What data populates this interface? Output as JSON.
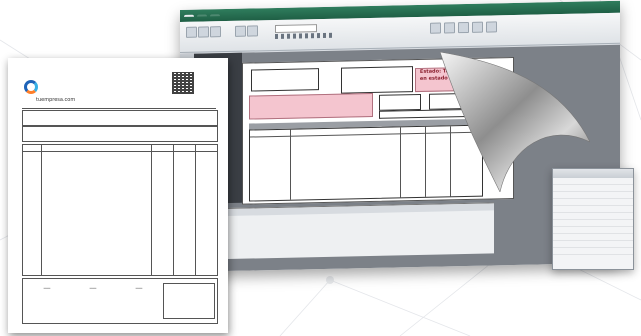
{
  "app": {
    "tabs": [
      "",
      "",
      ""
    ],
    "ribbon_labels": [
      "",
      "",
      "",
      "",
      ""
    ]
  },
  "document": {
    "status_label": "Estado: Transacción en estado Aceptado",
    "columns": [
      "",
      "",
      "",
      ""
    ]
  },
  "invoice": {
    "logo_text": "tuempresa.com"
  },
  "properties": {
    "title": "",
    "rows": [
      "",
      "",
      "",
      "",
      "",
      "",
      "",
      "",
      "",
      "",
      ""
    ]
  },
  "colors": {
    "status_pink": "#f4c5cf",
    "titlebar_green": "#2f7d5d",
    "logo_blue": "#1e63b8",
    "logo_cyan": "#37b0e6",
    "logo_orange": "#ff7f2a"
  }
}
